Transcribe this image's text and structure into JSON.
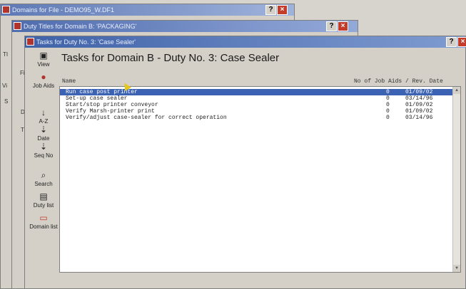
{
  "windows": {
    "w1_title": "Domains for File - DEMO95_W.DF1",
    "w2_title": "Duty Titles for Domain B: 'PACKAGING'",
    "w3_title": "Tasks for Duty No. 3: 'Case Sealer'"
  },
  "side_letters": [
    "TI",
    "Fi",
    "Vi",
    "S",
    "D",
    "T"
  ],
  "toolbar": [
    {
      "label": "View",
      "icon": "view-icon",
      "glyph": "▣"
    },
    {
      "label": "Job Aids",
      "icon": "job-aids-icon",
      "glyph": "●"
    },
    {
      "label": "A-Z",
      "icon": "sort-az-icon",
      "glyph": "↓"
    },
    {
      "label": "Date",
      "icon": "sort-date-icon",
      "glyph": "⇣"
    },
    {
      "label": "Seq No",
      "icon": "sort-seq-icon",
      "glyph": "⇣"
    },
    {
      "label": "Search",
      "icon": "search-icon",
      "glyph": "⌕"
    },
    {
      "label": "Duty list",
      "icon": "duty-list-icon",
      "glyph": "▤"
    },
    {
      "label": "Domain list",
      "icon": "domain-list-icon",
      "glyph": "▭"
    }
  ],
  "heading": "Tasks for Domain B - Duty No. 3:  Case Sealer",
  "columns": {
    "name": "Name",
    "aids_date": "No of Job Aids / Rev. Date"
  },
  "rows": [
    {
      "name": "Run case post printer",
      "aids": "0",
      "date": "01/09/02"
    },
    {
      "name": "Set-up case sealer",
      "aids": "0",
      "date": "03/14/96"
    },
    {
      "name": "Start/stop printer conveyor",
      "aids": "0",
      "date": "01/09/02"
    },
    {
      "name": "Verify Marsh-printer print",
      "aids": "0",
      "date": "01/09/02"
    },
    {
      "name": "Verify/adjust case-sealer for correct operation",
      "aids": "0",
      "date": "03/14/96"
    }
  ],
  "colors": {
    "title": "#3f62a8",
    "selection": "#3c62b4",
    "close": "#c43b2a"
  }
}
